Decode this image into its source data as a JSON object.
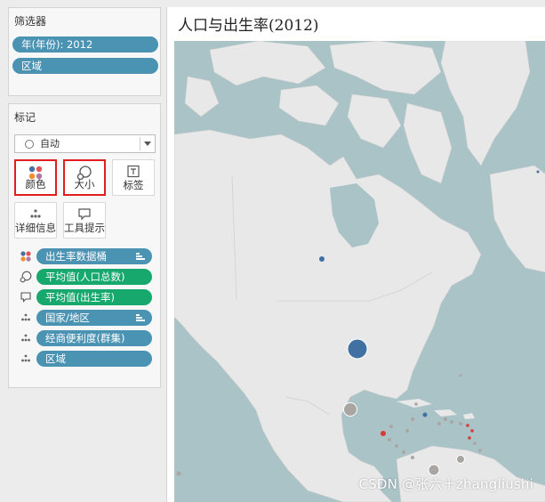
{
  "filters": {
    "title": "筛选器",
    "items": [
      "年(年份): 2012",
      "区域"
    ]
  },
  "marks": {
    "title": "标记",
    "mark_type": "自动",
    "buttons": {
      "color": "颜色",
      "size": "大小",
      "label": "标签",
      "detail": "详细信息",
      "tooltip": "工具提示"
    },
    "fields": [
      {
        "label": "出生率数据桶",
        "role": "color",
        "pill": "blue",
        "sorted": true
      },
      {
        "label": "平均值(人口总数)",
        "role": "size",
        "pill": "green",
        "sorted": false
      },
      {
        "label": "平均值(出生率)",
        "role": "tooltip",
        "pill": "green",
        "sorted": false
      },
      {
        "label": "国家/地区",
        "role": "detail",
        "pill": "blue",
        "sorted": true
      },
      {
        "label": "经商便利度(群集)",
        "role": "detail",
        "pill": "blue",
        "sorted": false
      },
      {
        "label": "区域",
        "role": "detail",
        "pill": "blue",
        "sorted": false
      }
    ]
  },
  "viz": {
    "title": "人口与出生率(2012)"
  },
  "watermark": "CSDN @张六十zhangliushi",
  "colors": {
    "pill_blue": "#4a93b3",
    "pill_green": "#17a86e",
    "selection_border": "#e21d1d",
    "ocean": "#a9c3c7",
    "land": "#e8e8e8",
    "mark_blue": "#4170a3",
    "mark_gray": "#a9a5a3",
    "mark_red": "#d83a3a"
  }
}
